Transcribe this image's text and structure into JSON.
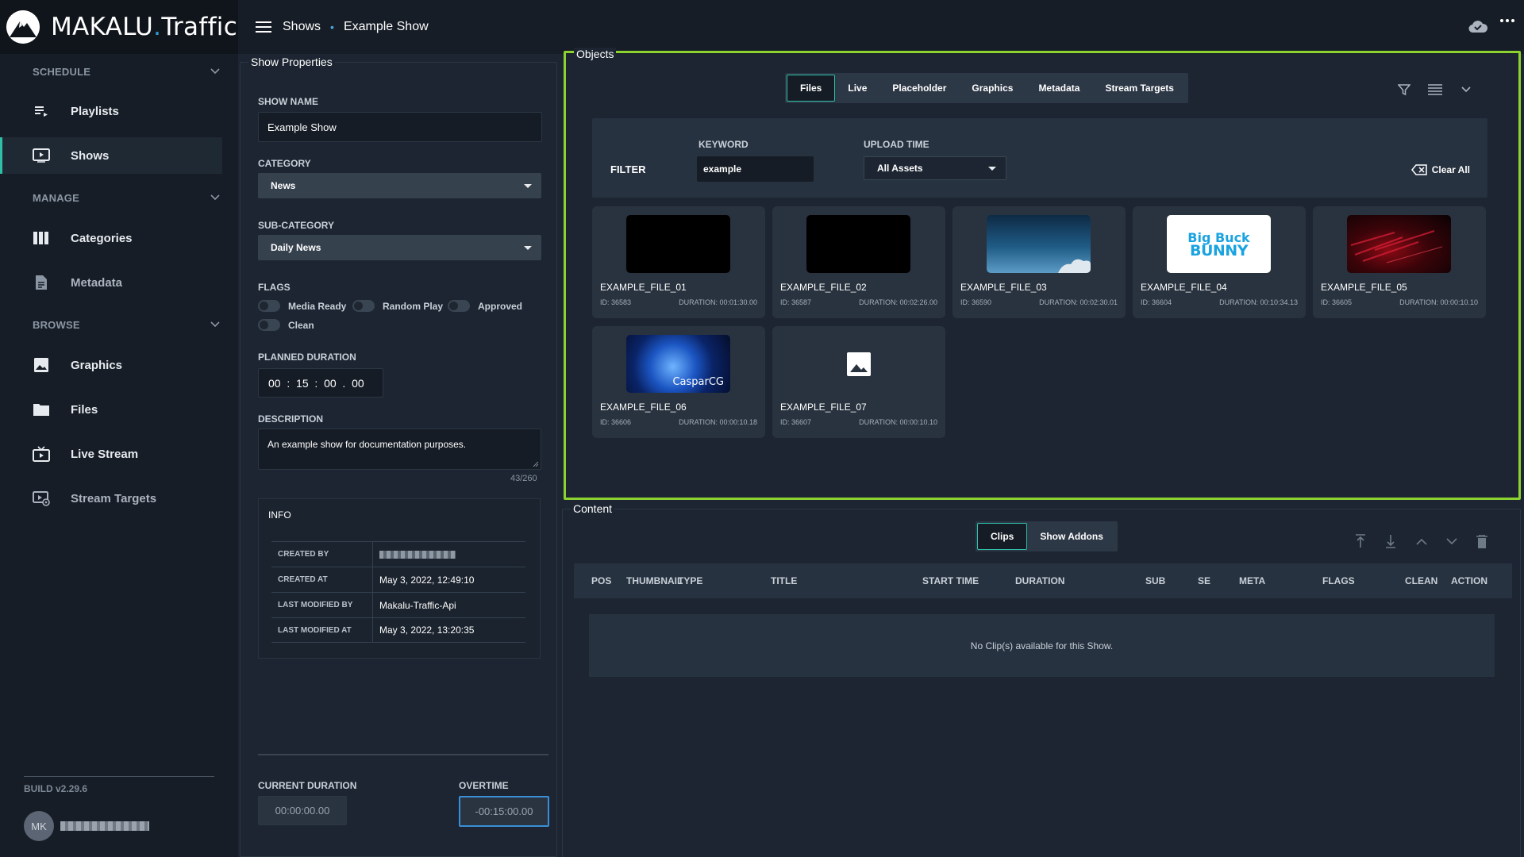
{
  "app": {
    "brand_left": "MAKALU",
    "brand_dot": ".",
    "brand_right": "Traffic"
  },
  "breadcrumb": {
    "root": "Shows",
    "separator": "•",
    "current": "Example Show"
  },
  "sidebar": {
    "sections": [
      {
        "label": "SCHEDULE"
      },
      {
        "label": "MANAGE"
      },
      {
        "label": "BROWSE"
      }
    ],
    "items": [
      {
        "label": "Playlists",
        "icon": "playlist-icon"
      },
      {
        "label": "Shows",
        "icon": "play-box-icon",
        "active": true
      },
      {
        "label": "Categories",
        "icon": "columns-icon"
      },
      {
        "label": "Metadata",
        "icon": "document-icon"
      },
      {
        "label": "Graphics",
        "icon": "image-icon"
      },
      {
        "label": "Files",
        "icon": "folder-icon"
      },
      {
        "label": "Live Stream",
        "icon": "live-tv-icon"
      },
      {
        "label": "Stream Targets",
        "icon": "stream-target-icon"
      }
    ],
    "build": "BUILD v2.29.6",
    "user_initials": "MK"
  },
  "show_properties": {
    "legend": "Show Properties",
    "show_name_label": "SHOW NAME",
    "show_name": "Example Show",
    "category_label": "CATEGORY",
    "category": "News",
    "subcategory_label": "SUB-CATEGORY",
    "subcategory": "Daily News",
    "flags_label": "FLAGS",
    "flags": [
      "Media Ready",
      "Random Play",
      "Approved",
      "Clean"
    ],
    "planned_duration_label": "PLANNED DURATION",
    "planned": {
      "hh": "00",
      "mm": "15",
      "ss": "00",
      "ff": "00"
    },
    "description_label": "DESCRIPTION",
    "description": "An example show for documentation purposes.",
    "char_count": "43/260",
    "info": {
      "title": "INFO",
      "created_by_label": "CREATED BY",
      "created_at_label": "CREATED AT",
      "created_at": "May 3, 2022, 12:49:10",
      "modified_by_label": "LAST MODIFIED BY",
      "modified_by": "Makalu-Traffic-Api",
      "modified_at_label": "LAST MODIFIED AT",
      "modified_at": "May 3, 2022, 13:20:35"
    },
    "current_duration_label": "CURRENT DURATION",
    "current_duration": "00:00:00.00",
    "overtime_label": "OVERTIME",
    "overtime": "-00:15:00.00"
  },
  "objects": {
    "legend": "Objects",
    "tabs": [
      "Files",
      "Live",
      "Placeholder",
      "Graphics",
      "Metadata",
      "Stream Targets"
    ],
    "active_tab": "Files",
    "filter_label": "FILTER",
    "keyword_label": "KEYWORD",
    "keyword": "example",
    "upload_label": "UPLOAD TIME",
    "upload": "All Assets",
    "clear_all": "Clear All",
    "files": [
      {
        "name": "EXAMPLE_FILE_01",
        "id": "ID: 36583",
        "duration": "DURATION: 00:01:30.00",
        "thumb": "black"
      },
      {
        "name": "EXAMPLE_FILE_02",
        "id": "ID: 36587",
        "duration": "DURATION: 00:02:26.00",
        "thumb": "black"
      },
      {
        "name": "EXAMPLE_FILE_03",
        "id": "ID: 36590",
        "duration": "DURATION: 00:02:30.01",
        "thumb": "sky"
      },
      {
        "name": "EXAMPLE_FILE_04",
        "id": "ID: 36604",
        "duration": "DURATION: 00:10:34.13",
        "thumb": "bunny",
        "thumb_text_1": "Big Buck",
        "thumb_text_2": "BUNNY"
      },
      {
        "name": "EXAMPLE_FILE_05",
        "id": "ID: 36605",
        "duration": "DURATION: 00:00:10.10",
        "thumb": "red"
      },
      {
        "name": "EXAMPLE_FILE_06",
        "id": "ID: 36606",
        "duration": "DURATION: 00:00:10.18",
        "thumb": "globe",
        "thumb_text_1": "CasparCG"
      },
      {
        "name": "EXAMPLE_FILE_07",
        "id": "ID: 36607",
        "duration": "DURATION: 00:00:10.10",
        "thumb": "placeholder"
      }
    ]
  },
  "content": {
    "legend": "Content",
    "tabs": [
      "Clips",
      "Show Addons"
    ],
    "active_tab": "Clips",
    "columns": [
      "POS",
      "THUMBNAIL",
      "TYPE",
      "TITLE",
      "START TIME",
      "DURATION",
      "SUB",
      "SE",
      "META",
      "FLAGS",
      "CLEAN",
      "ACTION"
    ],
    "empty_message": "No Clip(s) available for this Show."
  },
  "colors": {
    "accent": "#2fbfa6",
    "highlight": "#8cd230",
    "overtime_border": "#3a8fd6",
    "bg": "#1c2531",
    "sidebar": "#161d26"
  }
}
